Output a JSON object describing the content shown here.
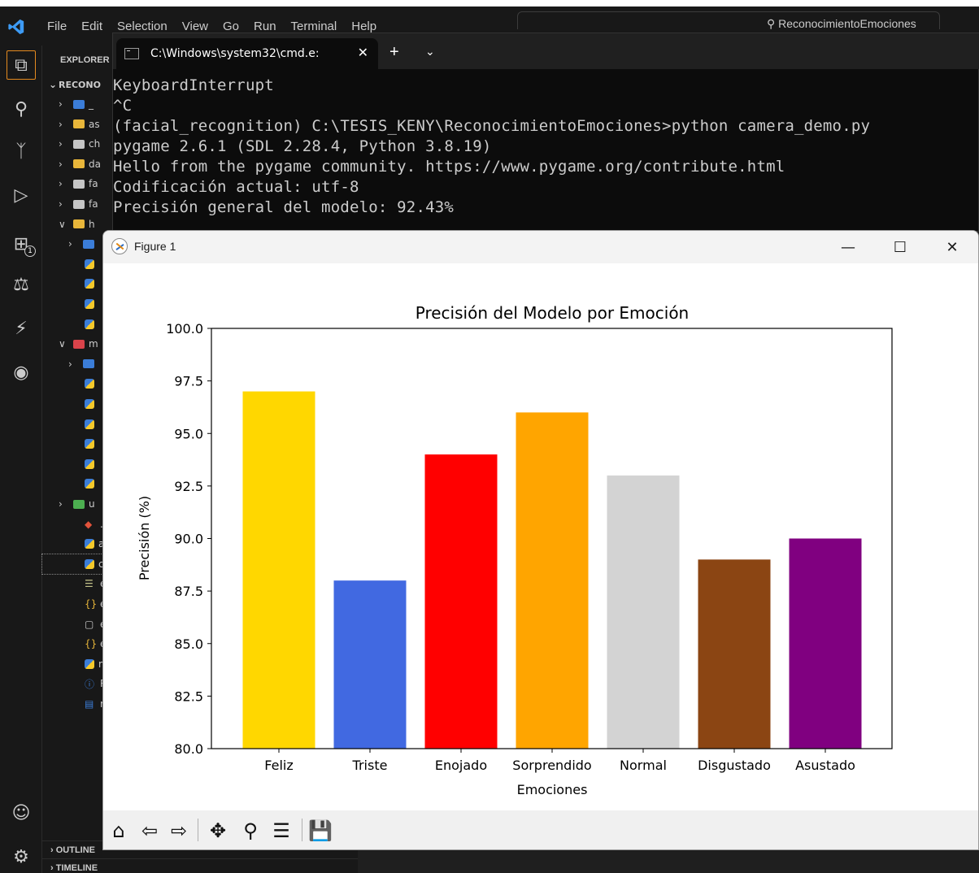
{
  "vscode": {
    "menu": [
      "File",
      "Edit",
      "Selection",
      "View",
      "Go",
      "Run",
      "Terminal",
      "Help"
    ],
    "search_text": "ReconocimientoEmociones",
    "explorer_header": "EXPLORER",
    "root_folder": "RECONO",
    "tree": [
      {
        "label": "_",
        "kind": "folder-blue"
      },
      {
        "label": "as",
        "kind": "folder-yellow"
      },
      {
        "label": "ch",
        "kind": "folder-grey"
      },
      {
        "label": "da",
        "kind": "folder-yellow"
      },
      {
        "label": "fa",
        "kind": "folder-grey"
      },
      {
        "label": "fa",
        "kind": "folder-grey"
      },
      {
        "label": "h",
        "kind": "folder-open"
      },
      {
        "label": "",
        "kind": "folder-blue"
      },
      {
        "label": "",
        "kind": "py"
      },
      {
        "label": "",
        "kind": "py"
      },
      {
        "label": "",
        "kind": "py"
      },
      {
        "label": "",
        "kind": "py"
      },
      {
        "label": "m",
        "kind": "folder-red"
      },
      {
        "label": "",
        "kind": "folder-blue"
      },
      {
        "label": "",
        "kind": "py"
      },
      {
        "label": "",
        "kind": "py"
      },
      {
        "label": "",
        "kind": "py"
      },
      {
        "label": "",
        "kind": "py"
      },
      {
        "label": "",
        "kind": "py"
      },
      {
        "label": "",
        "kind": "py"
      },
      {
        "label": "u",
        "kind": "folder-green"
      },
      {
        "label": ".g",
        "kind": "git"
      },
      {
        "label": "a",
        "kind": "py"
      },
      {
        "label": "c",
        "kind": "py"
      },
      {
        "label": "e",
        "kind": "text"
      },
      {
        "label": "e",
        "kind": "json"
      },
      {
        "label": "e",
        "kind": "file"
      },
      {
        "label": "e",
        "kind": "json"
      },
      {
        "label": "m",
        "kind": "py"
      },
      {
        "label": "R",
        "kind": "info"
      },
      {
        "label": "re",
        "kind": "doc"
      }
    ],
    "outline_label": "OUTLINE",
    "timeline_label": "TIMELINE",
    "source_control_badge": "1"
  },
  "cmd": {
    "tab_title": "C:\\Windows\\system32\\cmd.e:",
    "lines": [
      "KeyboardInterrupt",
      "^C",
      "(facial_recognition) C:\\TESIS_KENY\\ReconocimientoEmociones>python camera_demo.py",
      "pygame 2.6.1 (SDL 2.28.4, Python 3.8.19)",
      "Hello from the pygame community. https://www.pygame.org/contribute.html",
      "Codificación actual: utf-8",
      "Precisión general del modelo: 92.43%"
    ]
  },
  "figure": {
    "window_title": "Figure 1"
  },
  "chart_data": {
    "type": "bar",
    "title": "Precisión del Modelo por Emoción",
    "xlabel": "Emociones",
    "ylabel": "Precisión (%)",
    "categories": [
      "Feliz",
      "Triste",
      "Enojado",
      "Sorprendido",
      "Normal",
      "Disgustado",
      "Asustado"
    ],
    "values": [
      97,
      88,
      94,
      96,
      93,
      89,
      90
    ],
    "colors": [
      "#ffd700",
      "#4169e1",
      "#ff0000",
      "#ffa500",
      "#d3d3d3",
      "#8b4513",
      "#800080"
    ],
    "ylim": [
      80,
      100
    ],
    "yticks": [
      "80.0",
      "82.5",
      "85.0",
      "87.5",
      "90.0",
      "92.5",
      "95.0",
      "97.5",
      "100.0"
    ],
    "grid": false
  }
}
